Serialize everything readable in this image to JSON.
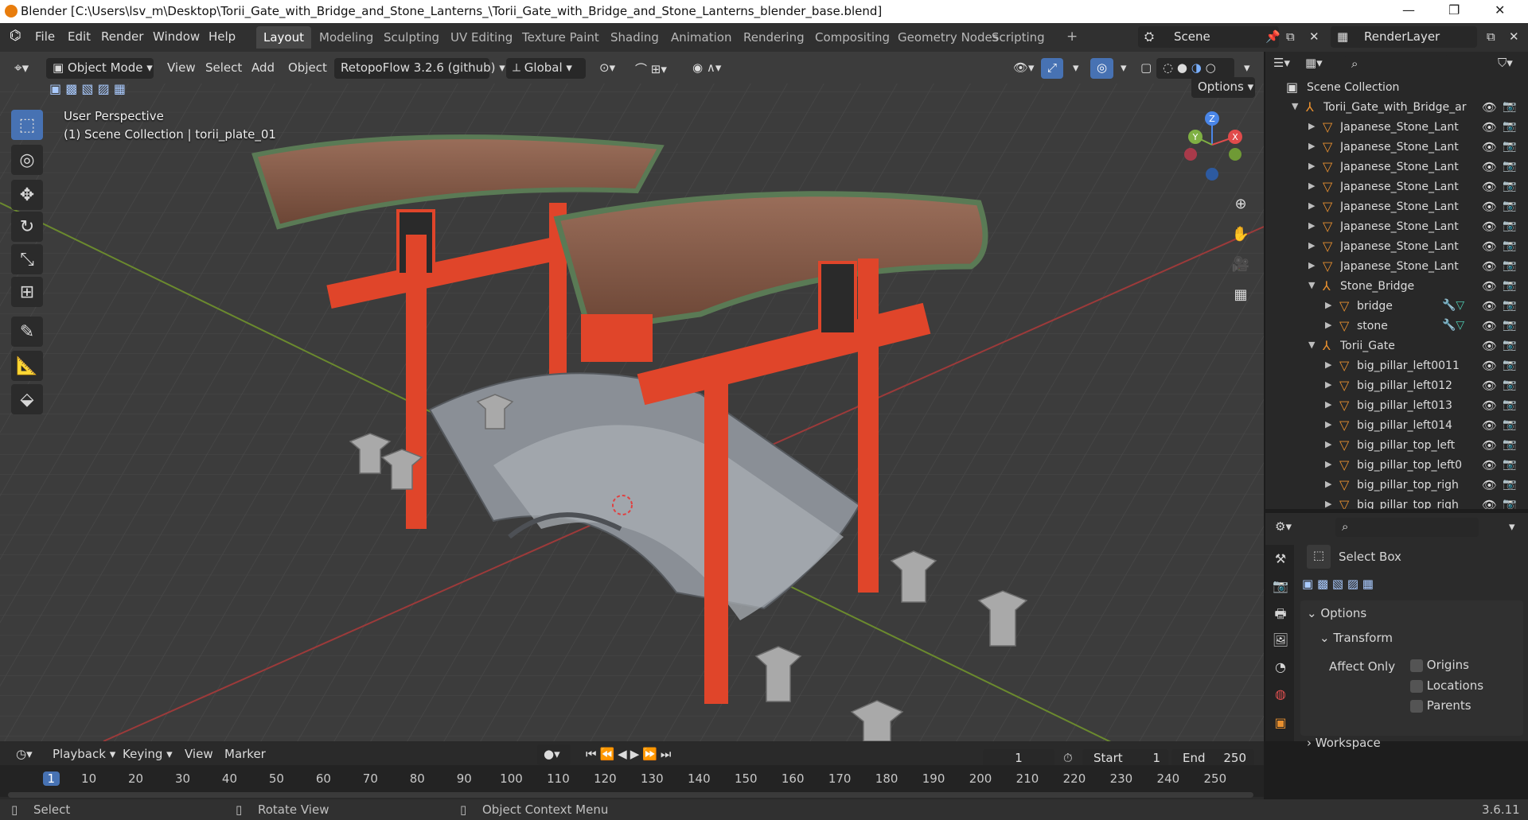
{
  "window": {
    "title": "Blender [C:\\Users\\lsv_m\\Desktop\\Torii_Gate_with_Bridge_and_Stone_Lanterns_\\Torii_Gate_with_Bridge_and_Stone_Lanterns_blender_base.blend]",
    "minimize": "—",
    "maximize": "❐",
    "close": "✕"
  },
  "menu": {
    "items": [
      "File",
      "Edit",
      "Render",
      "Window",
      "Help"
    ]
  },
  "workspaces": [
    "Layout",
    "Modeling",
    "Sculpting",
    "UV Editing",
    "Texture Paint",
    "Shading",
    "Animation",
    "Rendering",
    "Compositing",
    "Geometry Nodes",
    "Scripting",
    "+"
  ],
  "scene": {
    "name": "Scene",
    "view_layer": "RenderLayer"
  },
  "viewport_header": {
    "mode": "Object Mode",
    "menus": [
      "View",
      "Select",
      "Add",
      "Object"
    ],
    "addon": "RetopoFlow 3.2.6 (github)",
    "orientation": "Global",
    "options": "Options"
  },
  "viewport": {
    "perspective": "User Perspective",
    "collection_info": "(1) Scene Collection | torii_plate_01",
    "gizmo": {
      "z": "Z",
      "y": "Y",
      "x": "X"
    }
  },
  "outliner": {
    "root": "Scene Collection",
    "rows": [
      {
        "label": "Torii_Gate_with_Bridge_ar",
        "type": "collection",
        "indent": 1,
        "expanded": true
      },
      {
        "label": "Japanese_Stone_Lant",
        "type": "mesh",
        "indent": 2
      },
      {
        "label": "Japanese_Stone_Lant",
        "type": "mesh",
        "indent": 2
      },
      {
        "label": "Japanese_Stone_Lant",
        "type": "mesh",
        "indent": 2
      },
      {
        "label": "Japanese_Stone_Lant",
        "type": "mesh",
        "indent": 2
      },
      {
        "label": "Japanese_Stone_Lant",
        "type": "mesh",
        "indent": 2
      },
      {
        "label": "Japanese_Stone_Lant",
        "type": "mesh",
        "indent": 2
      },
      {
        "label": "Japanese_Stone_Lant",
        "type": "mesh",
        "indent": 2
      },
      {
        "label": "Japanese_Stone_Lant",
        "type": "mesh",
        "indent": 2
      },
      {
        "label": "Stone_Bridge",
        "type": "empty",
        "indent": 2,
        "expanded": true
      },
      {
        "label": "bridge",
        "type": "mesh",
        "indent": 3,
        "extras": true
      },
      {
        "label": "stone",
        "type": "mesh",
        "indent": 3,
        "extras": true
      },
      {
        "label": "Torii_Gate",
        "type": "empty",
        "indent": 2,
        "expanded": true
      },
      {
        "label": "big_pillar_left0011",
        "type": "mesh",
        "indent": 3
      },
      {
        "label": "big_pillar_left012",
        "type": "mesh",
        "indent": 3
      },
      {
        "label": "big_pillar_left013",
        "type": "mesh",
        "indent": 3
      },
      {
        "label": "big_pillar_left014",
        "type": "mesh",
        "indent": 3
      },
      {
        "label": "big_pillar_top_left",
        "type": "mesh",
        "indent": 3
      },
      {
        "label": "big_pillar_top_left0",
        "type": "mesh",
        "indent": 3
      },
      {
        "label": "big_pillar_top_righ",
        "type": "mesh",
        "indent": 3
      },
      {
        "label": "big_pillar_top_righ",
        "type": "mesh",
        "indent": 3
      }
    ]
  },
  "properties": {
    "tool": "Select Box",
    "options": "Options",
    "transform": "Transform",
    "affect_only": "Affect Only",
    "checkboxes": [
      "Origins",
      "Locations",
      "Parents"
    ],
    "workspace": "Workspace"
  },
  "timeline": {
    "menus": [
      "Playback",
      "Keying",
      "View",
      "Marker"
    ],
    "current_frame": "1",
    "start_label": "Start",
    "start": "1",
    "end_label": "End",
    "end": "250",
    "ruler": [
      "1",
      "10",
      "20",
      "30",
      "40",
      "50",
      "60",
      "70",
      "80",
      "90",
      "100",
      "110",
      "120",
      "130",
      "140",
      "150",
      "160",
      "170",
      "180",
      "190",
      "200",
      "210",
      "220",
      "230",
      "240",
      "250"
    ]
  },
  "statusbar": {
    "select": "Select",
    "rotate": "Rotate View",
    "context": "Object Context Menu",
    "version": "3.6.11"
  },
  "colors": {
    "accent": "#4772b3",
    "active_frame": "#4772b3",
    "torii_red": "#e0452a",
    "stone": "#8a8f96",
    "mesh_icon": "#e8902f"
  }
}
